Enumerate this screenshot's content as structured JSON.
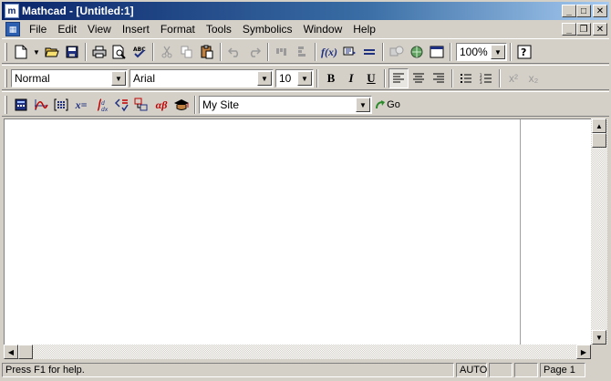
{
  "window": {
    "title": "Mathcad - [Untitled:1]",
    "app_icon_letter": "m",
    "minimize": "_",
    "maximize": "□",
    "close": "✕",
    "restore": "❐"
  },
  "menubar": {
    "items": [
      "File",
      "Edit",
      "View",
      "Insert",
      "Format",
      "Tools",
      "Symbolics",
      "Window",
      "Help"
    ]
  },
  "standard_toolbar": {
    "buttons": [
      "new-icon",
      "new-dropdown-icon",
      "open-icon",
      "save-icon",
      "print-icon",
      "print-preview-icon",
      "spell-check-icon",
      "cut-icon",
      "copy-icon",
      "paste-icon",
      "undo-icon",
      "redo-icon",
      "align-across-icon",
      "align-down-icon",
      "insert-function-icon",
      "insert-unit-icon",
      "calculate-icon",
      "component-icon",
      "resource-center-icon",
      "worksheet-icon",
      "help-icon"
    ],
    "zoom": "100%"
  },
  "formatting_toolbar": {
    "style": "Normal",
    "font": "Arial",
    "size": "10",
    "bold": "B",
    "italic": "I",
    "underline": "U",
    "superscript": "x²",
    "subscript": "x₂"
  },
  "math_toolbar": {
    "buttons": [
      "calculator-icon",
      "graph-icon",
      "matrix-icon",
      "evaluation-icon",
      "calculus-icon",
      "boolean-icon",
      "programming-icon",
      "greek-icon",
      "symbolic-icon"
    ],
    "evaluation_label": "x=",
    "greek_label": "αβ",
    "site": "My Site",
    "go_label": "Go"
  },
  "statusbar": {
    "help": "Press F1 for help.",
    "mode": "AUTO",
    "page": "Page 1"
  },
  "colors": {
    "title_start": "#0a246a",
    "title_end": "#a6caf0",
    "face": "#d4d0c8"
  }
}
